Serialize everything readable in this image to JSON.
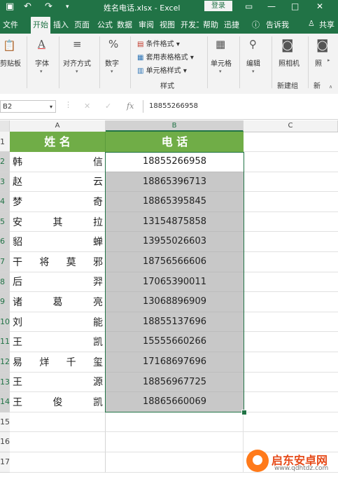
{
  "titlebar": {
    "document_title": "姓名电话.xlsx  -  Excel",
    "login_label": "登录",
    "save_icon": "save-icon",
    "undo_icon": "undo-icon",
    "redo_icon": "redo-icon"
  },
  "tabs": [
    "文件",
    "开始",
    "插入",
    "页面",
    "公式",
    "数据",
    "审阅",
    "视图",
    "开发工具",
    "帮助",
    "迅捷",
    "告诉我",
    "共享"
  ],
  "active_tab": "开始",
  "ribbon": {
    "paste_label": "剪贴板",
    "font_label": "字体",
    "align_label": "对齐方式",
    "number_label": "数字",
    "cond_format": "条件格式",
    "table_format": "套用表格格式",
    "cell_style": "单元格样式",
    "styles_group": "样式",
    "cells_label": "单元格",
    "edit_label": "编辑",
    "camera_label": "照相机",
    "camera2_label": "照",
    "new_group_label": "新建组",
    "new_group2_label": "新",
    "font_icon_char": "A",
    "number_icon_char": "%"
  },
  "formula_bar": {
    "name_box": "B2",
    "fx_label": "fx",
    "cancel_char": "✕",
    "confirm_char": "✓",
    "value": "18855266958"
  },
  "columns": [
    "A",
    "B",
    "C"
  ],
  "rows": [
    "1",
    "2",
    "3",
    "4",
    "5",
    "6",
    "7",
    "8",
    "9",
    "10",
    "11",
    "12",
    "13",
    "14",
    "15",
    "16",
    "17"
  ],
  "headers": {
    "name": "姓  名",
    "phone": "电  话"
  },
  "names": [
    [
      "韩",
      "信"
    ],
    [
      "赵",
      "云"
    ],
    [
      "梦",
      "奇"
    ],
    [
      "安",
      "其",
      "拉"
    ],
    [
      "貂",
      "蝉"
    ],
    [
      "干",
      "将",
      "莫",
      "邪"
    ],
    [
      "后",
      "羿"
    ],
    [
      "诸",
      "葛",
      "亮"
    ],
    [
      "刘",
      "能"
    ],
    [
      "王",
      "凯"
    ],
    [
      "易",
      "烊",
      "千",
      "玺"
    ],
    [
      "王",
      "源"
    ],
    [
      "王",
      "俊",
      "凯"
    ]
  ],
  "phones": [
    "18855266958",
    "18865396713",
    "18865395845",
    "13154875858",
    "13955026603",
    "18756566606",
    "17065390011",
    "13068896909",
    "18855137696",
    "15555660266",
    "17168697696",
    "18856967725",
    "18865660069"
  ],
  "colors": {
    "excel_green": "#217346",
    "header_green": "#70ad47",
    "selection_gray": "#c8c8c8"
  },
  "watermark": {
    "brand": "启东安卓网",
    "url": "www.qdhtdz.com"
  }
}
